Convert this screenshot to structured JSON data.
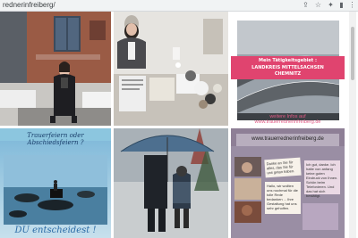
{
  "browser": {
    "url": "rednerinfreiberg/",
    "icons": [
      "share-icon",
      "star-icon",
      "extension-icon",
      "sidebar-icon",
      "profile-icon",
      "menu-icon"
    ]
  },
  "tiles": {
    "flyer1": {
      "heading": "Mein Tätigkeitsgebiet :",
      "line1": "LANDKREIS MITTELSACHSEN",
      "line2": "CHEMNITZ",
      "info": "weitere Infos auf",
      "website": "www.trauerrednerinfreiberg.de"
    },
    "piano": {
      "title": "Trauerfeiern oder Abschiedsfeiern ?",
      "caption": "DU entscheidest !"
    },
    "collage": {
      "website": "www.trauerrednerinfreiberg.de",
      "note1": "Danke an Sie für alles, das Sie für uns getan haben.",
      "note2": "Hallo, wir wollten uns nochmal für die tolle Rede bedanken ... Ihre Gestaltung hat uns sehr geholfen.",
      "note3": "Ich gut, danke. Ich hatte von anfang keine guten Eindruck von Ihnen. Schön beim Telefonieren. Und das hat sich bestätigt."
    }
  },
  "colors": {
    "pink": "#e35a86",
    "bar": "#f1f3f4"
  }
}
